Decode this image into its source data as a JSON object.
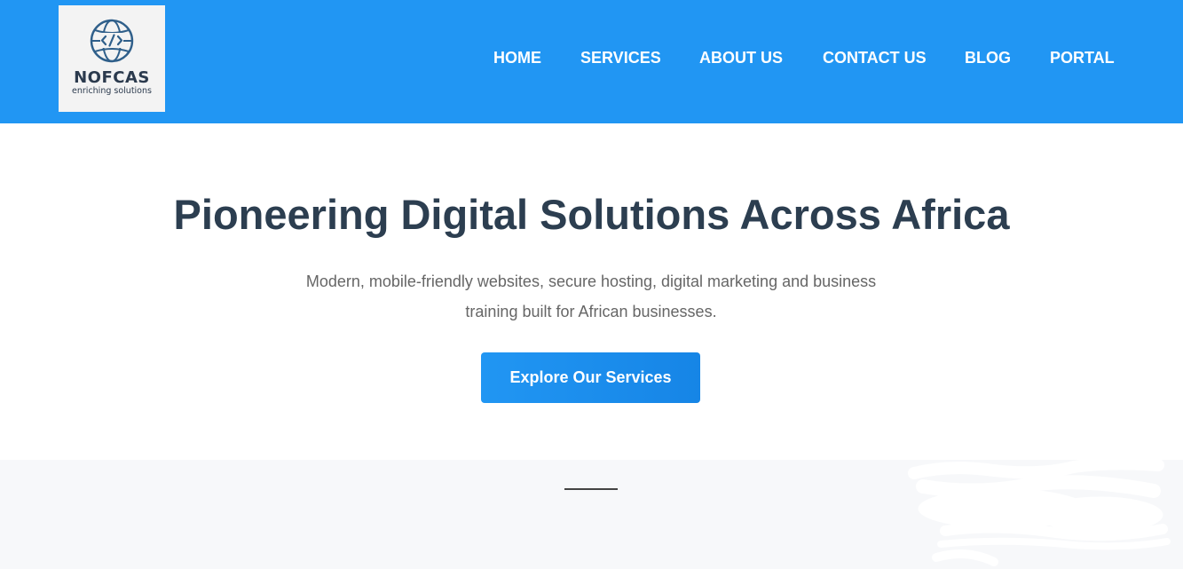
{
  "header": {
    "logo": {
      "name": "NOFCAS",
      "tagline": "enriching solutions",
      "icon": "globe-code-icon"
    },
    "nav": [
      {
        "label": "HOME"
      },
      {
        "label": "SERVICES"
      },
      {
        "label": "ABOUT US"
      },
      {
        "label": "CONTACT US"
      },
      {
        "label": "BLOG"
      },
      {
        "label": "PORTAL"
      }
    ]
  },
  "hero": {
    "title": "Pioneering Digital Solutions Across Africa",
    "subtitle_line1": "Modern, mobile-friendly websites, secure hosting, digital marketing and business",
    "subtitle_line2": "training built for African businesses.",
    "cta_label": "Explore Our Services"
  },
  "colors": {
    "header_bg": "#2196f3",
    "title": "#2c3e50",
    "subtitle": "#666666",
    "cta_bg": "#2196f3",
    "section_bg": "#f7f8fa"
  }
}
